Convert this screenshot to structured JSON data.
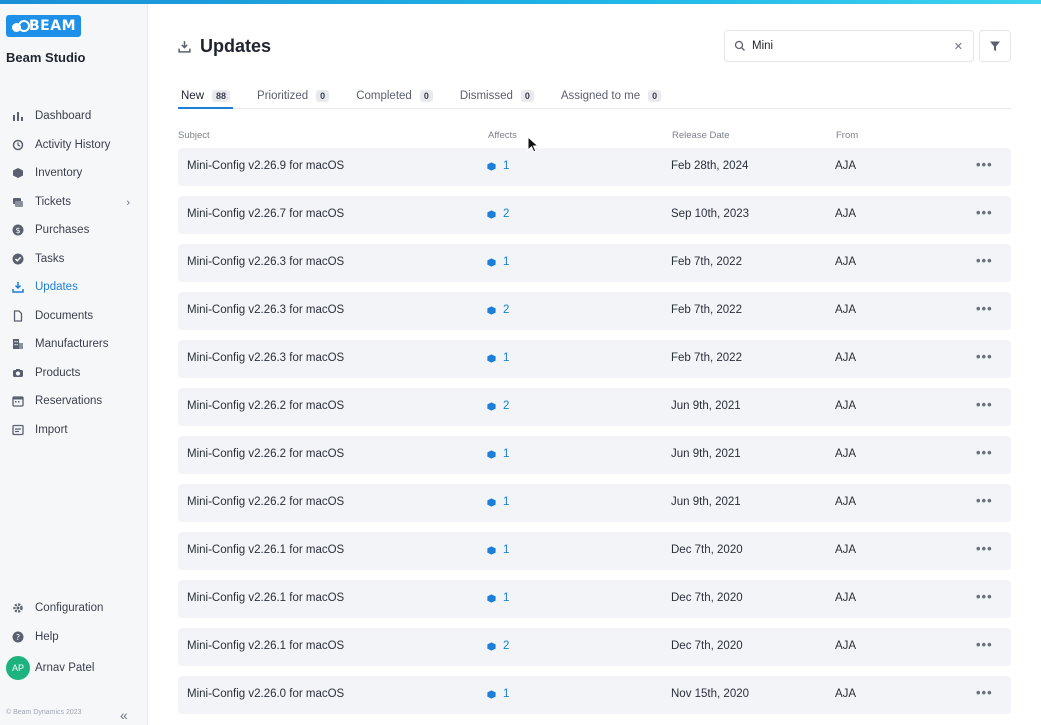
{
  "app": {
    "logo_text": "BEAM",
    "workspace": "Beam Studio",
    "footer": "© Beam Dynamics 2023"
  },
  "sidebar": {
    "items": [
      {
        "label": "Dashboard",
        "icon": "bar-chart-icon"
      },
      {
        "label": "Activity History",
        "icon": "history-icon"
      },
      {
        "label": "Inventory",
        "icon": "box-icon"
      },
      {
        "label": "Tickets",
        "icon": "tickets-icon"
      },
      {
        "label": "Purchases",
        "icon": "dollar-icon"
      },
      {
        "label": "Tasks",
        "icon": "check-circle-icon"
      },
      {
        "label": "Updates",
        "icon": "download-icon"
      },
      {
        "label": "Documents",
        "icon": "document-icon"
      },
      {
        "label": "Manufacturers",
        "icon": "building-icon"
      },
      {
        "label": "Products",
        "icon": "camera-icon"
      },
      {
        "label": "Reservations",
        "icon": "calendar-icon"
      },
      {
        "label": "Import",
        "icon": "import-icon"
      }
    ],
    "bottom": [
      {
        "label": "Configuration",
        "icon": "gear-icon"
      },
      {
        "label": "Help",
        "icon": "help-icon"
      }
    ],
    "user": {
      "initials": "AP",
      "name": "Arnav Patel"
    }
  },
  "header": {
    "title": "Updates"
  },
  "search": {
    "value": "Mini"
  },
  "tabs": [
    {
      "label": "New",
      "count": "88"
    },
    {
      "label": "Prioritized",
      "count": "0"
    },
    {
      "label": "Completed",
      "count": "0"
    },
    {
      "label": "Dismissed",
      "count": "0"
    },
    {
      "label": "Assigned to me",
      "count": "0"
    }
  ],
  "table": {
    "columns": {
      "subject": "Subject",
      "affects": "Affects",
      "release_date": "Release Date",
      "from": "From"
    },
    "rows": [
      {
        "subject": "Mini-Config v2.26.9 for macOS",
        "affects": "1",
        "date": "Feb 28th, 2024",
        "from": "AJA"
      },
      {
        "subject": "Mini-Config v2.26.7 for macOS",
        "affects": "2",
        "date": "Sep 10th, 2023",
        "from": "AJA"
      },
      {
        "subject": "Mini-Config v2.26.3 for macOS",
        "affects": "1",
        "date": "Feb 7th, 2022",
        "from": "AJA"
      },
      {
        "subject": "Mini-Config v2.26.3 for macOS",
        "affects": "2",
        "date": "Feb 7th, 2022",
        "from": "AJA"
      },
      {
        "subject": "Mini-Config v2.26.3 for macOS",
        "affects": "1",
        "date": "Feb 7th, 2022",
        "from": "AJA"
      },
      {
        "subject": "Mini-Config v2.26.2 for macOS",
        "affects": "2",
        "date": "Jun 9th, 2021",
        "from": "AJA"
      },
      {
        "subject": "Mini-Config v2.26.2 for macOS",
        "affects": "1",
        "date": "Jun 9th, 2021",
        "from": "AJA"
      },
      {
        "subject": "Mini-Config v2.26.2 for macOS",
        "affects": "1",
        "date": "Jun 9th, 2021",
        "from": "AJA"
      },
      {
        "subject": "Mini-Config v2.26.1 for macOS",
        "affects": "1",
        "date": "Dec 7th, 2020",
        "from": "AJA"
      },
      {
        "subject": "Mini-Config v2.26.1 for macOS",
        "affects": "1",
        "date": "Dec 7th, 2020",
        "from": "AJA"
      },
      {
        "subject": "Mini-Config v2.26.1 for macOS",
        "affects": "2",
        "date": "Dec 7th, 2020",
        "from": "AJA"
      },
      {
        "subject": "Mini-Config v2.26.0 for macOS",
        "affects": "1",
        "date": "Nov 15th, 2020",
        "from": "AJA"
      }
    ]
  },
  "colors": {
    "accent": "#1e7fd6",
    "brand": "#1e90e8",
    "row_bg": "#f3f4f7",
    "avatar": "#1db37e"
  }
}
